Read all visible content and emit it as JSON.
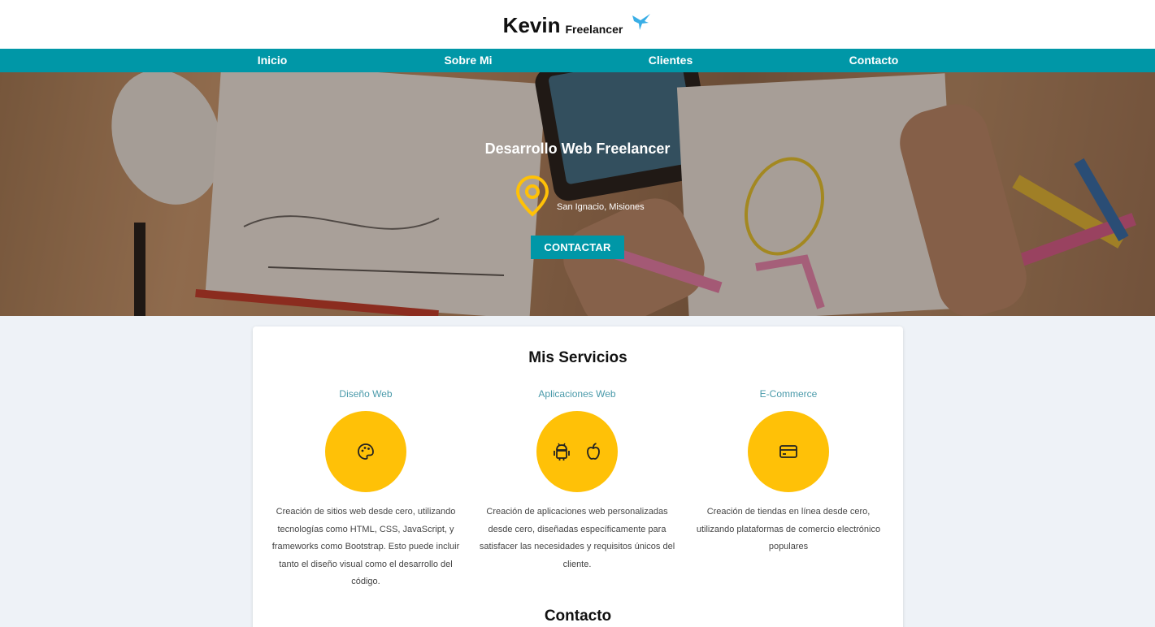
{
  "brand": {
    "name": "Kevin",
    "subtitle": "Freelancer"
  },
  "nav": {
    "items": [
      "Inicio",
      "Sobre Mi",
      "Clientes",
      "Contacto"
    ]
  },
  "hero": {
    "title": "Desarrollo Web Freelancer",
    "location": "San Ignacio, Misiones",
    "cta": "CONTACTAR"
  },
  "services": {
    "heading": "Mis Servicios",
    "items": [
      {
        "title": "Diseño Web",
        "icon": "palette-icon",
        "description": "Creación de sitios web desde cero, utilizando tecnologías como HTML, CSS, JavaScript, y frameworks como Bootstrap. Esto puede incluir tanto el diseño visual como el desarrollo del código."
      },
      {
        "title": "Aplicaciones Web",
        "icon": "android-apple-icons",
        "description": "Creación de aplicaciones web personalizadas desde cero, diseñadas específicamente para satisfacer las necesidades y requisitos únicos del cliente."
      },
      {
        "title": "E-Commerce",
        "icon": "credit-card-icon",
        "description": "Creación de tiendas en línea desde cero, utilizando plataformas de comercio electrónico populares"
      }
    ]
  },
  "contact": {
    "heading": "Contacto"
  },
  "colors": {
    "accent": "#0097a7",
    "yellow": "#ffc107",
    "service_title": "#4a9aaa"
  }
}
